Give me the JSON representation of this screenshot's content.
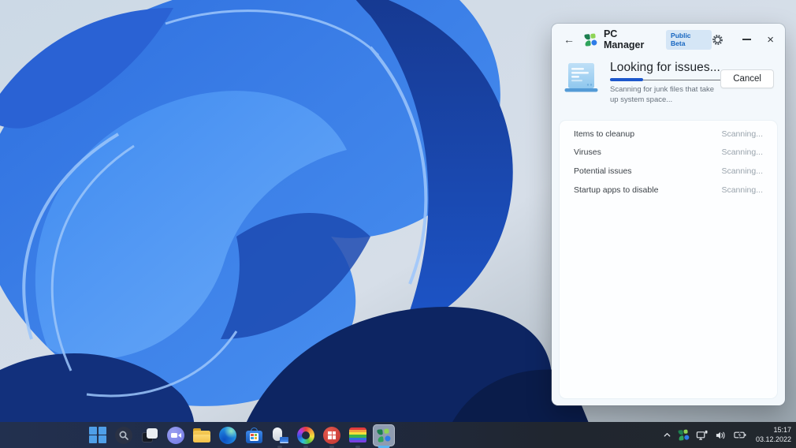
{
  "window": {
    "header": {
      "title": "PC Manager",
      "badge": "Public Beta"
    },
    "scan": {
      "heading": "Looking for issues...",
      "subtitle": "Scanning for junk files that take up system space...",
      "cancel_label": "Cancel",
      "progress_percent": 30
    },
    "issues": [
      {
        "label": "Items to cleanup",
        "status": "Scanning..."
      },
      {
        "label": "Viruses",
        "status": "Scanning..."
      },
      {
        "label": "Potential issues",
        "status": "Scanning..."
      },
      {
        "label": "Startup apps to disable",
        "status": "Scanning..."
      }
    ]
  },
  "taskbar": {
    "icons": [
      "start",
      "search",
      "task-view",
      "chat",
      "file-explorer",
      "edge",
      "microsoft-store",
      "device-utility",
      "color-wheel",
      "windows-tool",
      "color-profile",
      "pc-manager"
    ],
    "active_icon": "pc-manager",
    "tray": {
      "time": "15:17",
      "date": "03.12.2022"
    }
  },
  "colors": {
    "accent_blue": "#1c57cc",
    "badge_bg": "#d5e6f6",
    "badge_text": "#1565c0",
    "taskbar_indicator": "#5ab3f0",
    "pc_manager_green": "#2fa45c",
    "pc_manager_blue": "#2d7ce8"
  }
}
